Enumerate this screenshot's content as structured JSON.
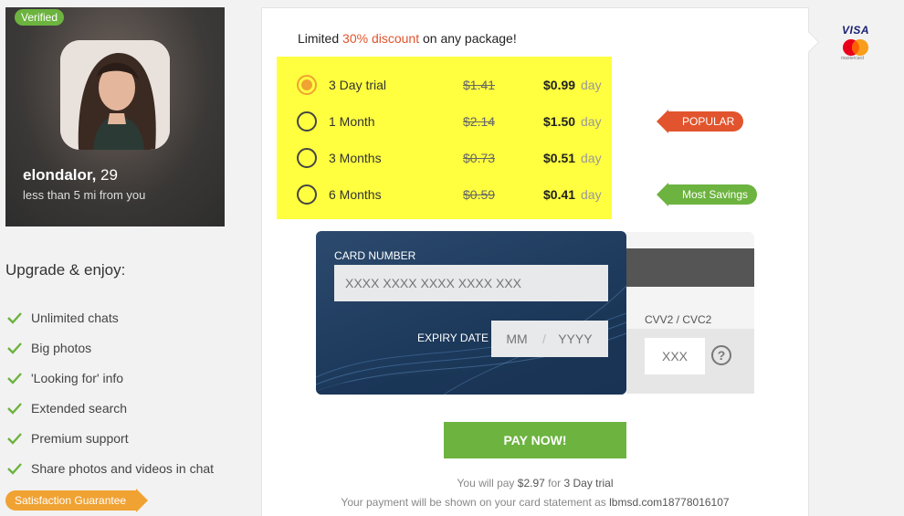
{
  "profile": {
    "verified_label": "Verified",
    "username": "elondalor,",
    "age": "29",
    "distance": "less than 5 mi from you"
  },
  "upgrade": {
    "title": "Upgrade & enjoy:",
    "features": [
      "Unlimited chats",
      "Big photos",
      "'Looking for' info",
      "Extended search",
      "Premium support",
      "Share photos and videos in chat"
    ],
    "guarantee_label": "Satisfaction Guarantee"
  },
  "discount": {
    "prefix": "Limited ",
    "highlight": "30% discount",
    "suffix": " on any package!"
  },
  "plans": [
    {
      "name": "3 Day trial",
      "old_price": "$1.41",
      "price": "$0.99",
      "unit": "day",
      "selected": true
    },
    {
      "name": "1 Month",
      "old_price": "$2.14",
      "price": "$1.50",
      "unit": "day",
      "selected": false
    },
    {
      "name": "3 Months",
      "old_price": "$0.73",
      "price": "$0.51",
      "unit": "day",
      "selected": false
    },
    {
      "name": "6 Months",
      "old_price": "$0.59",
      "price": "$0.41",
      "unit": "day",
      "selected": false
    }
  ],
  "tags": {
    "popular": "POPULAR",
    "savings": "Most Savings"
  },
  "card": {
    "number_label": "CARD NUMBER",
    "number_placeholder": "XXXX XXXX XXXX XXXX XXX",
    "expiry_label": "EXPIRY DATE",
    "expiry_mm_placeholder": "MM",
    "expiry_separator": "/",
    "expiry_yy_placeholder": "YYYY",
    "cvv_label": "CVV2 / CVC2",
    "cvv_placeholder": "XXX",
    "help_glyph": "?"
  },
  "payment": {
    "button_label": "PAY NOW!",
    "summary_prefix": "You will pay ",
    "summary_amount": "$2.97",
    "summary_mid": " for ",
    "summary_plan": "3 Day trial",
    "statement_prefix": "Your payment will be shown on your card statement as ",
    "statement_descriptor": "lbmsd.com18778016107"
  },
  "brands": {
    "visa": "VISA",
    "mastercard": "mastercard"
  },
  "colors": {
    "accent_orange": "#f0a232",
    "accent_green": "#6cb33f",
    "discount_red": "#e2542d",
    "plan_highlight": "#ffff40",
    "card_blue": "#1d3a5c"
  },
  "icons": {
    "check": "check-icon",
    "help": "question-circle-icon",
    "radio": "radio-button-icon"
  }
}
